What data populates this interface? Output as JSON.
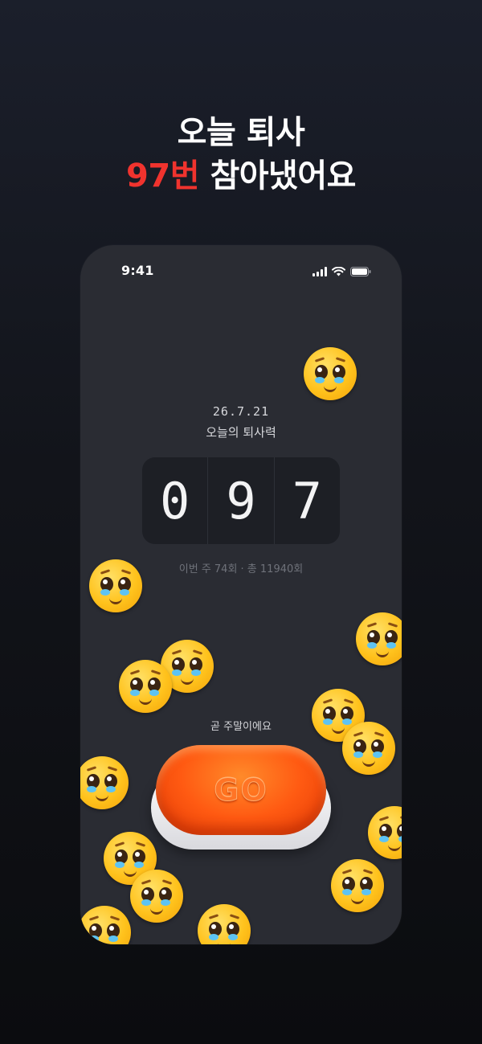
{
  "headline": {
    "line1": "오늘 퇴사",
    "line2_accent": "97번",
    "line2_rest": " 참아냈어요",
    "accent_color": "#f0332e"
  },
  "phone": {
    "status_bar": {
      "time": "9:41",
      "icons": [
        "signal-icon",
        "wifi-icon",
        "battery-icon"
      ]
    },
    "date": "26.7.21",
    "title": "오늘의 퇴사력",
    "counter": {
      "digits": [
        "0",
        "9",
        "7"
      ]
    },
    "weekly_stats": "이번 주 74회 · 총 11940회",
    "soon_text": "곧 주말이에요",
    "go_button": {
      "label": "GO",
      "color": "#ff5a12"
    },
    "emoji_name": "pleading-face-icon"
  }
}
